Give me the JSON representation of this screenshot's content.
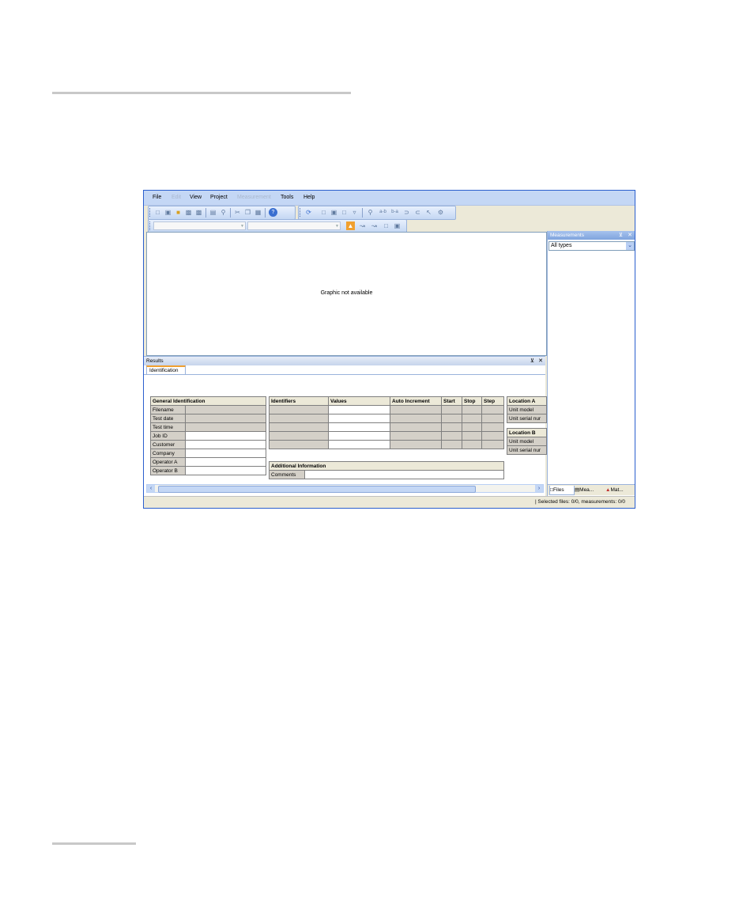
{
  "window": {
    "menu": [
      {
        "label": "File",
        "enabled": true
      },
      {
        "label": "Edit",
        "enabled": false
      },
      {
        "label": "View",
        "enabled": true
      },
      {
        "label": "Project",
        "enabled": true
      },
      {
        "label": "Measurement",
        "enabled": false
      },
      {
        "label": "Tools",
        "enabled": true
      },
      {
        "label": "Help",
        "enabled": true
      }
    ]
  },
  "graph": {
    "message": "Graphic not available"
  },
  "measurements_panel": {
    "title": "Measurements",
    "filter_value": "All types",
    "tabs": [
      "Files",
      "Mea...",
      "Mat..."
    ]
  },
  "results": {
    "title": "Results",
    "tab": "Identification",
    "general": {
      "header": "General Identification",
      "rows": [
        "Filename",
        "Test date",
        "Test time",
        "Job ID",
        "Customer",
        "Company",
        "Operator A",
        "Operator B"
      ]
    },
    "identifiers": {
      "headers": [
        "Identifiers",
        "Values",
        "Auto Increment",
        "Start",
        "Stop",
        "Step"
      ]
    },
    "additional": {
      "header": "Additional Information",
      "comments_label": "Comments"
    },
    "location_a": {
      "header": "Location A",
      "rows": [
        "Unit model",
        "Unit serial nur"
      ]
    },
    "location_b": {
      "header": "Location B",
      "rows": [
        "Unit model",
        "Unit serial nur"
      ]
    }
  },
  "status": {
    "text": "| Selected files: 0/0, measurements: 0/0"
  }
}
